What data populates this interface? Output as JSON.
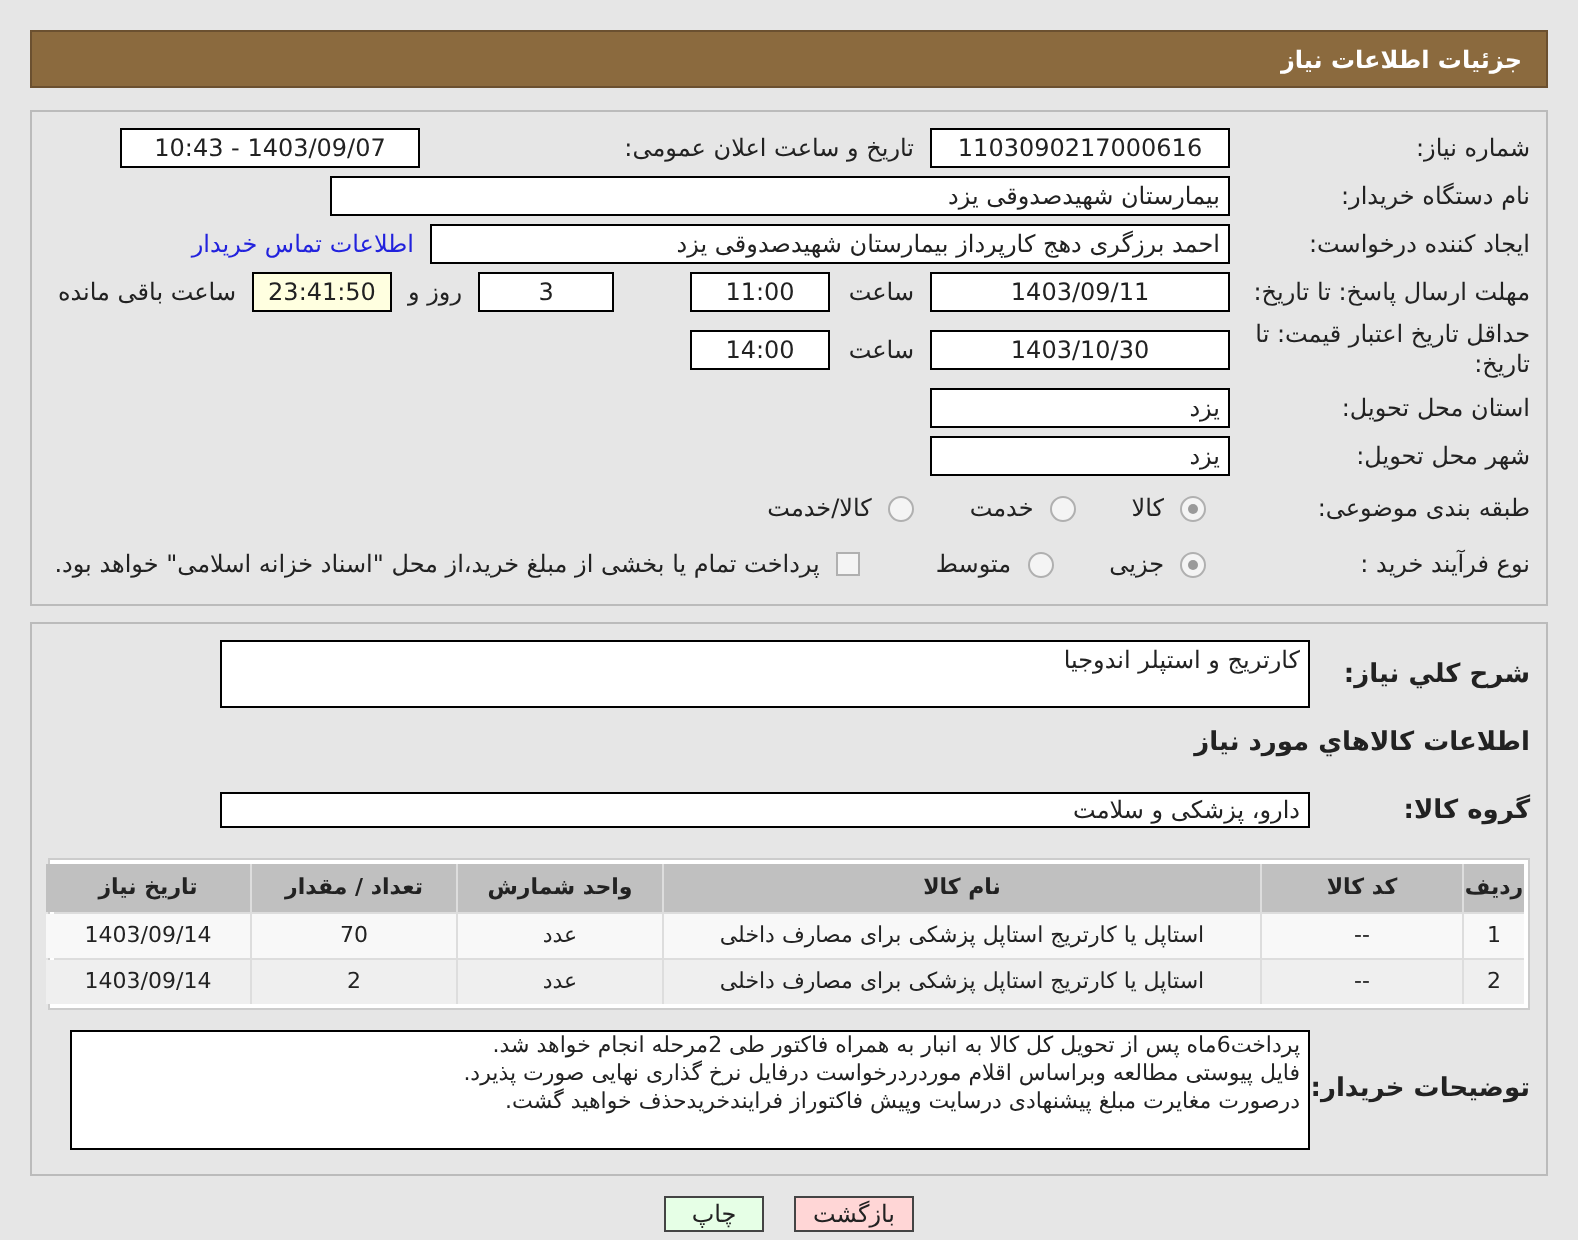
{
  "header": {
    "title": "جزئیات اطلاعات نیاز"
  },
  "need_number": {
    "label": "شماره نیاز:",
    "value": "1103090217000616"
  },
  "announce": {
    "label": "تاریخ و ساعت اعلان عمومی:",
    "value": "1403/09/07 - 10:43"
  },
  "buyer": {
    "label": "نام دستگاه خریدار:",
    "value": "بیمارستان شهیدصدوقی یزد"
  },
  "creator": {
    "label": "ایجاد کننده درخواست:",
    "value": "احمد برزگری دهج کارپرداز بیمارستان شهیدصدوقی یزد",
    "link": "اطلاعات تماس خریدار"
  },
  "deadline": {
    "label": "مهلت ارسال پاسخ: تا تاریخ:",
    "date": "1403/09/11",
    "time_label": "ساعت",
    "time": "11:00",
    "days": "3",
    "days_label": "روز و",
    "remaining": "23:41:50",
    "remaining_label": "ساعت باقی مانده"
  },
  "validity": {
    "label": "حداقل تاریخ اعتبار قیمت: تا تاریخ:",
    "date": "1403/10/30",
    "time_label": "ساعت",
    "time": "14:00"
  },
  "province": {
    "label": "استان محل تحویل:",
    "value": "یزد"
  },
  "city": {
    "label": "شهر محل تحویل:",
    "value": "یزد"
  },
  "category": {
    "label": "طبقه بندی موضوعی:",
    "options": [
      {
        "label": "کالا",
        "selected": true
      },
      {
        "label": "خدمت",
        "selected": false
      },
      {
        "label": "کالا/خدمت",
        "selected": false
      }
    ]
  },
  "process": {
    "label": "نوع فرآیند خرید :",
    "options": [
      {
        "label": "جزیی",
        "selected": true
      },
      {
        "label": "متوسط",
        "selected": false
      }
    ],
    "treasury": {
      "label": "پرداخت تمام یا بخشی از مبلغ خرید،از محل \"اسناد خزانه اسلامی\" خواهد بود.",
      "checked": false
    }
  },
  "summary": {
    "label": "شرح کلي نياز:",
    "value": "کارتریج و استپلر اندوجیا"
  },
  "goods_title": "اطلاعات کالاهاي مورد نياز",
  "goods_group": {
    "label": "گروه کالا:",
    "value": "دارو، پزشکی و سلامت"
  },
  "table": {
    "columns": [
      "ردیف",
      "کد کالا",
      "نام کالا",
      "واحد شمارش",
      "تعداد / مقدار",
      "تاریخ نیاز"
    ],
    "rows": [
      [
        "1",
        "--",
        "استاپل یا کارتریج استاپل پزشکی برای مصارف داخلی",
        "عدد",
        "70",
        "1403/09/14"
      ],
      [
        "2",
        "--",
        "استاپل یا کارتریج استاپل پزشکی برای مصارف داخلی",
        "عدد",
        "2",
        "1403/09/14"
      ]
    ]
  },
  "notes": {
    "label": "توضیحات خریدار:",
    "lines": [
      "پرداخت6ماه پس از تحویل کل کالا به انبار به همراه فاکتور طی 2مرحله انجام خواهد شد.",
      "فایل پیوستی مطالعه وبراساس اقلام موردردرخواست درفایل نرخ گذاری نهایی  صورت پذیرد.",
      "درصورت مغایرت مبلغ پیشنهادی درسایت وپیش فاکتوراز فرایندخریدحذف خواهید گشت."
    ]
  },
  "buttons": [
    {
      "label": "بازگشت",
      "kind": "back"
    },
    {
      "label": "چاپ",
      "kind": "print"
    }
  ]
}
